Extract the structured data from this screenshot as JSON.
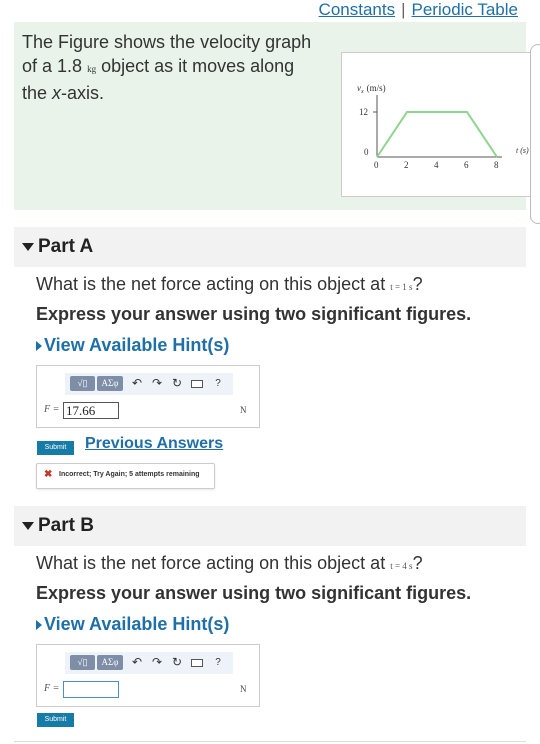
{
  "header": {
    "constants_link": "Constants",
    "separator": "|",
    "periodic_table_link": "Periodic Table"
  },
  "intro": {
    "text_before": "The Figure shows the velocity graph of a 1.8",
    "mass_unit": "kg",
    "text_after_1": "object as it moves along the",
    "axis_var": "x",
    "text_after_2": "-axis."
  },
  "graph": {
    "y_axis_label": "v",
    "y_axis_subscript": "x",
    "y_axis_unit": "(m/s)",
    "x_axis_label": "t (s)",
    "y_tick_label": "12",
    "y_zero_label": "0",
    "x_tick_labels": [
      "0",
      "2",
      "4",
      "6",
      "8"
    ],
    "line_color": "#8fd48f",
    "points": [
      {
        "t": 0,
        "v": 0
      },
      {
        "t": 2,
        "v": 12
      },
      {
        "t": 6,
        "v": 12
      },
      {
        "t": 8,
        "v": 0
      }
    ]
  },
  "part_a": {
    "title": "Part A",
    "question_before": "What is the net force acting on this object at",
    "question_math": "t = 1 s",
    "question_after": "?",
    "instruction": "Express your answer using two significant figures.",
    "hint_link": "View Available Hint(s)",
    "toolbar": {
      "template_label": "√▯",
      "greek_label": "ΑΣφ",
      "undo_icon": "↶",
      "redo_icon": "↷",
      "reset_icon": "↻",
      "help_label": "?"
    },
    "var_label": "F =",
    "input_value": "17.66",
    "unit": "N",
    "submit_label": "Submit",
    "previous_answers_link": "Previous Answers",
    "feedback_icon": "✖",
    "feedback_text": "Incorrect; Try Again; 5 attempts remaining"
  },
  "part_b": {
    "title": "Part B",
    "question_before": "What is the net force acting on this object at",
    "question_math": "t = 4 s",
    "question_after": "?",
    "instruction": "Express your answer using two significant figures.",
    "hint_link": "View Available Hint(s)",
    "toolbar": {
      "template_label": "√▯",
      "greek_label": "ΑΣφ",
      "undo_icon": "↶",
      "redo_icon": "↷",
      "reset_icon": "↻",
      "help_label": "?"
    },
    "var_label": "F =",
    "input_value": "",
    "unit": "N",
    "submit_label": "Submit"
  }
}
